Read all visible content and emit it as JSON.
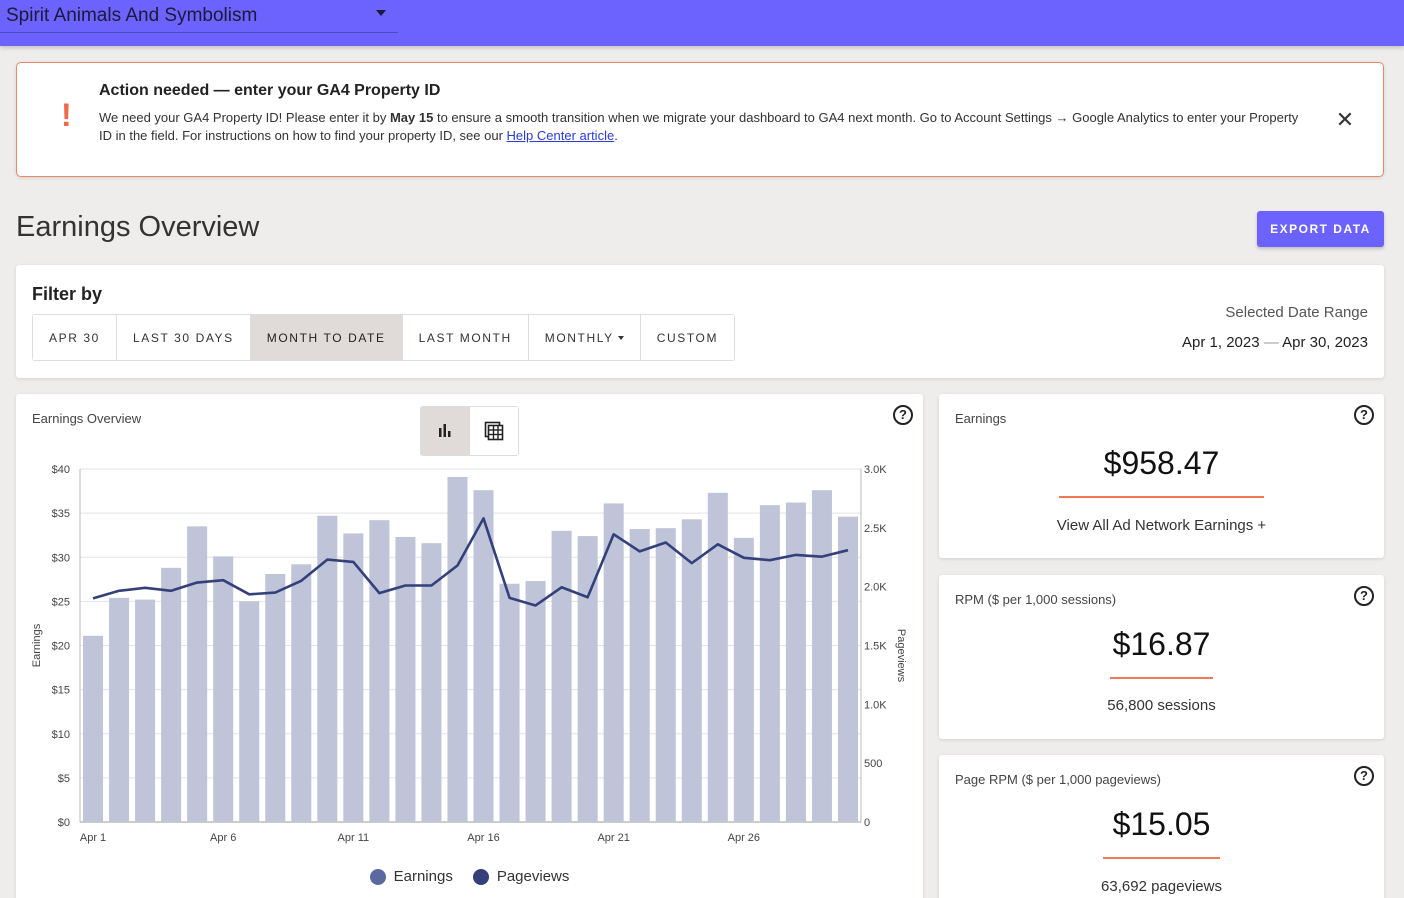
{
  "header": {
    "site_name": "Spirit Animals And Symbolism"
  },
  "alert": {
    "icon": "!",
    "title": "Action needed — enter your GA4 Property ID",
    "text_1": "We need your GA4 Property ID! Please enter it by ",
    "deadline": "May 15",
    "text_2": " to ensure a smooth transition when we migrate your dashboard to GA4 next month. Go to Account Settings → Google Analytics to enter your Property ID in the field. For instructions on how to find your property ID, see our ",
    "link": "Help Center article",
    "text_3": ".",
    "close": "✕",
    "accent": "#ef6a4c"
  },
  "page": {
    "title": "Earnings Overview",
    "export_label": "EXPORT DATA"
  },
  "filter": {
    "title": "Filter by",
    "buttons": [
      "APR 30",
      "LAST 30 DAYS",
      "MONTH TO DATE",
      "LAST MONTH",
      "MONTHLY",
      "CUSTOM"
    ],
    "active": "MONTH TO DATE",
    "range_label": "Selected Date Range",
    "range_start": "Apr 1, 2023",
    "range_sep": "—",
    "range_end": "Apr 30, 2023"
  },
  "chart_card": {
    "title": "Earnings Overview",
    "help": "?",
    "bar_icon": "bar-chart-icon",
    "table_icon": "table-icon"
  },
  "chart_data": {
    "type": "bar",
    "title": "Earnings Overview",
    "ylabel": "Earnings",
    "y2label": "Pageviews",
    "ylim": [
      0,
      40
    ],
    "y2lim": [
      0,
      3000
    ],
    "yticks": [
      "$0",
      "$5",
      "$10",
      "$15",
      "$20",
      "$25",
      "$30",
      "$35",
      "$40"
    ],
    "y2ticks": [
      "0",
      "500",
      "1.0K",
      "1.5K",
      "2.0K",
      "2.5K",
      "3.0K"
    ],
    "xtick_labels": [
      {
        "index": 0,
        "label": "Apr 1"
      },
      {
        "index": 5,
        "label": "Apr 6"
      },
      {
        "index": 10,
        "label": "Apr 11"
      },
      {
        "index": 15,
        "label": "Apr 16"
      },
      {
        "index": 20,
        "label": "Apr 21"
      },
      {
        "index": 25,
        "label": "Apr 26"
      }
    ],
    "grid": true,
    "legend": "bottom-center",
    "series": [
      {
        "name": "Earnings",
        "type": "bar",
        "color": "#bfc4d9",
        "legend_color": "#5b6a9e",
        "values": [
          21.1,
          25.4,
          25.2,
          28.8,
          33.5,
          30.1,
          25.0,
          28.1,
          29.2,
          34.7,
          32.7,
          34.2,
          32.3,
          31.6,
          39.1,
          37.6,
          27.0,
          27.3,
          33.0,
          32.4,
          36.1,
          33.2,
          33.3,
          34.3,
          37.3,
          32.2,
          35.9,
          36.2,
          37.6,
          34.6
        ]
      },
      {
        "name": "Pageviews",
        "type": "line",
        "color": "#33407a",
        "values": [
          1900,
          1965,
          1990,
          1965,
          2035,
          2055,
          1935,
          1950,
          2050,
          2230,
          2210,
          1945,
          2010,
          2010,
          2180,
          2580,
          1905,
          1840,
          1995,
          1910,
          2445,
          2300,
          2375,
          2200,
          2360,
          2245,
          2225,
          2270,
          2255,
          2310
        ]
      }
    ]
  },
  "stats": [
    {
      "label": "Earnings",
      "value": "$958.47",
      "sub": "View All Ad Network Earnings +",
      "help": "?"
    },
    {
      "label": "RPM ($ per 1,000 sessions)",
      "value": "$16.87",
      "sub": "56,800 sessions",
      "help": "?"
    },
    {
      "label": "Page RPM ($ per 1,000 pageviews)",
      "value": "$15.05",
      "sub": "63,692 pageviews",
      "help": "?"
    }
  ]
}
